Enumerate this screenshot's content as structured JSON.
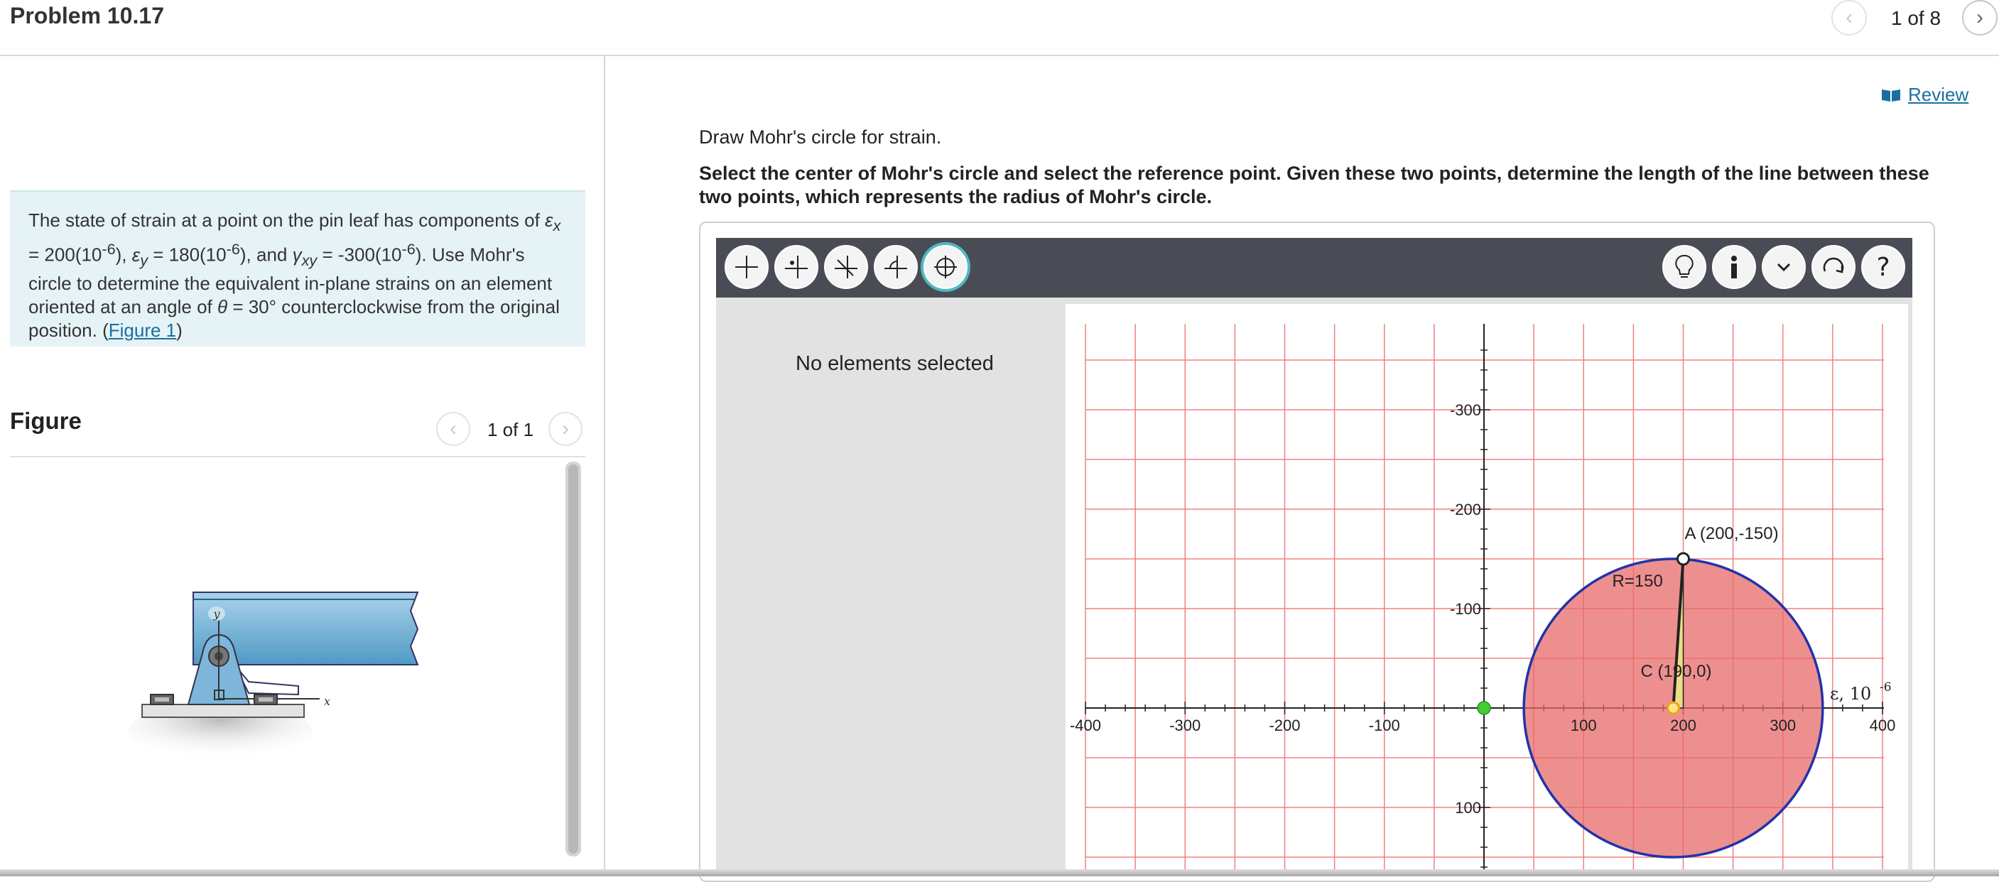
{
  "header": {
    "title": "Problem 10.17",
    "page_indicator": "1 of 8"
  },
  "problem": {
    "text_html": "The state of strain at a point on the pin leaf has components of <i>&#949;<sub>x</sub></i> = 200(10<sup>-6</sup>), <i>&#949;<sub>y</sub></i> = 180(10<sup>-6</sup>), and <i>&#947;<sub>xy</sub></i> = -300(10<sup>-6</sup>). Use Mohr's circle to determine the equivalent in-plane strains on an element oriented at an angle of <i>&#952;</i> = 30&#176; counterclockwise from the original position. (<a>Figure 1</a>)"
  },
  "figure": {
    "heading": "Figure",
    "page_indicator": "1 of 1",
    "labels": {
      "y": "y",
      "x": "x"
    }
  },
  "review": {
    "label": "Review"
  },
  "instructions": {
    "line1": "Draw Mohr's circle for strain.",
    "line2": "Select the center of Mohr's circle and select the reference point. Given these two points, determine the length of the line between these two points, which represents the radius of Mohr's circle."
  },
  "tool": {
    "panel_text": "No elements selected",
    "toolbar_right": [
      {
        "name": "hint-button",
        "icon": "lightbulb-icon"
      },
      {
        "name": "info-button",
        "icon": "info-icon"
      },
      {
        "name": "dropdown-button",
        "icon": "chevron-down-icon"
      },
      {
        "name": "reset-button",
        "icon": "rotate-icon"
      },
      {
        "name": "help-button",
        "icon": "question-icon",
        "label": "?"
      }
    ]
  },
  "graph": {
    "x_ticks": [
      "-400",
      "-300",
      "-200",
      "-100",
      "100",
      "200",
      "300",
      "400"
    ],
    "y_ticks": [
      "-300",
      "-200",
      "-100",
      "100"
    ],
    "axis_label_main": "ε, 10",
    "axis_label_exp": "-6",
    "point_A_label": "A (200,-150)",
    "point_C_label": "C (190,0)",
    "radius_label": "R=150",
    "center": {
      "x": 190,
      "y": 0
    },
    "point_A": {
      "x": 200,
      "y": -150
    },
    "origin_point": {
      "x": 0,
      "y": 0
    },
    "radius": 150,
    "colors": {
      "grid": "#f08080",
      "circle_fill": "#e86a6a",
      "circle_stroke": "#2233aa",
      "origin_point": "#44cc33",
      "center_point": "#f0a020"
    }
  }
}
